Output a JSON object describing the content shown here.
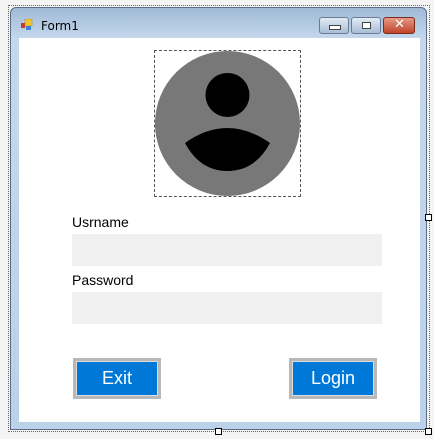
{
  "window": {
    "title": "Form1"
  },
  "form": {
    "username_label": "Usrname",
    "username_value": "",
    "password_label": "Password",
    "password_value": "",
    "exit_label": "Exit",
    "login_label": "Login"
  }
}
